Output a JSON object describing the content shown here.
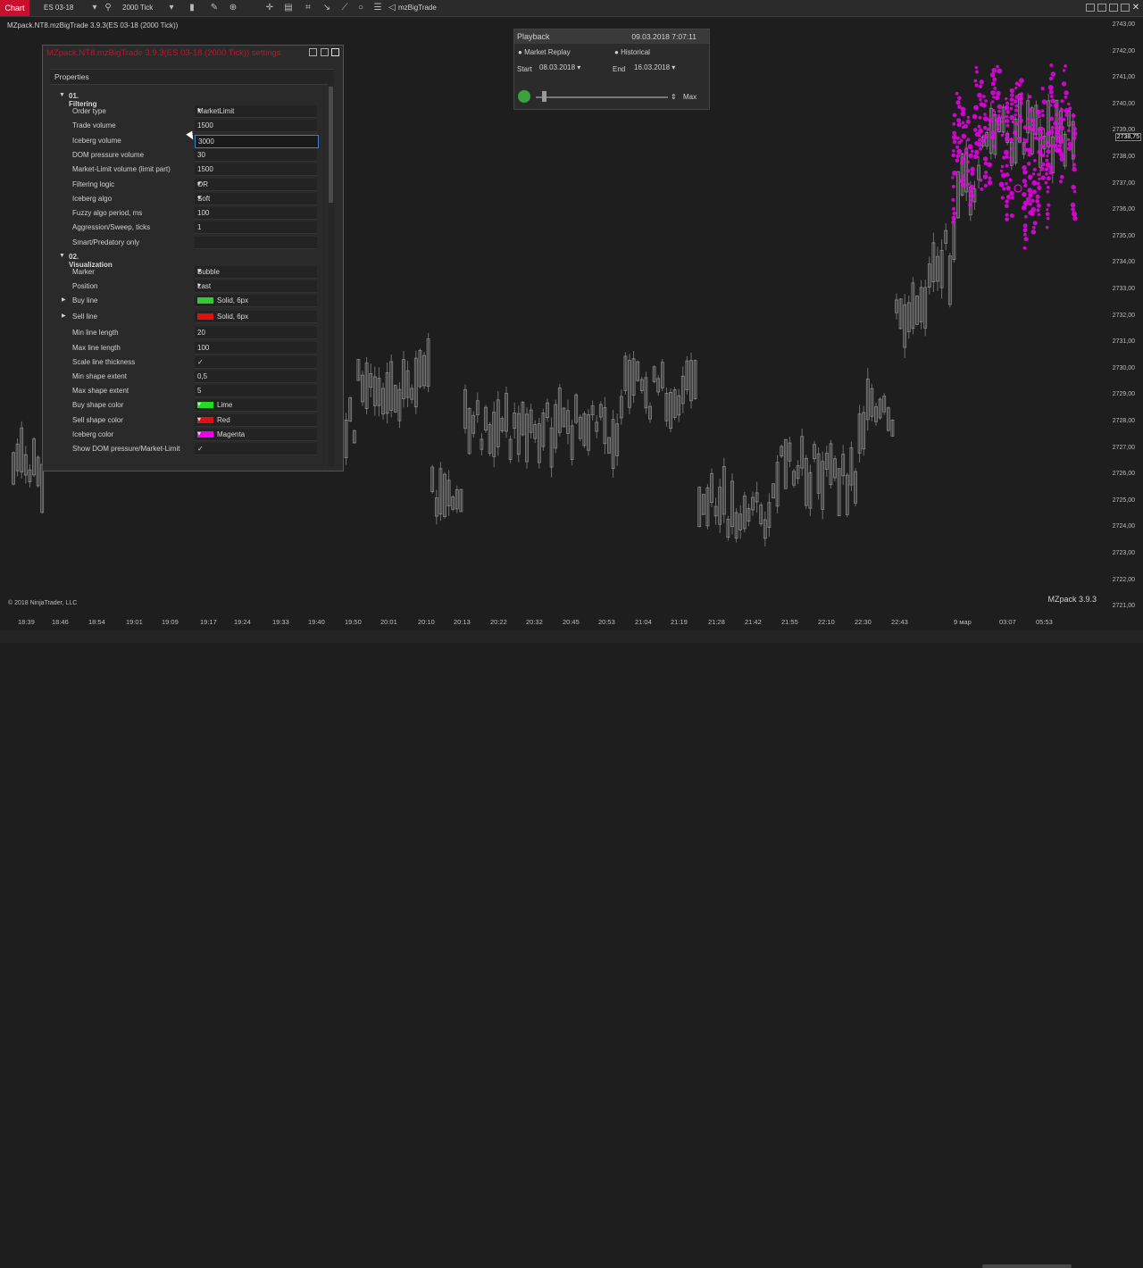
{
  "toolbar": {
    "chart_tab": "Chart",
    "instrument": "ES 03-18",
    "interval": "2000 Tick",
    "indicator": "mzBigTrade"
  },
  "chart": {
    "title": "MZpack.NT8.mzBigTrade 3.9.3(ES 03-18 (2000 Tick))",
    "copyright": "© 2018 NinjaTrader, LLC",
    "brand": "MZpack 3.9.3",
    "current_price": "2738,75",
    "price_labels": [
      "2743,00",
      "2742,00",
      "2741,00",
      "2740,00",
      "2739,00",
      "2738,00",
      "2737,00",
      "2736,00",
      "2735,00",
      "2734,00",
      "2733,00",
      "2732,00",
      "2731,00",
      "2730,00",
      "2729,00",
      "2728,00",
      "2727,00",
      "2726,00",
      "2725,00",
      "2724,00",
      "2723,00",
      "2722,00",
      "2721,00"
    ],
    "time_labels": [
      "18:39",
      "18:46",
      "18:54",
      "19:01",
      "19:09",
      "19:17",
      "19:24",
      "19:33",
      "19:40",
      "19:50",
      "20:01",
      "20:10",
      "20:13",
      "20:22",
      "20:32",
      "20:45",
      "20:53",
      "21:04",
      "21:19",
      "21:28",
      "21:42",
      "21:55",
      "22:10",
      "22:30",
      "22:43",
      "9 мар",
      "03:07",
      "05:53"
    ]
  },
  "settings": {
    "title": "MZpack.NT8.mzBigTrade 3.9.3(ES 03-18 (2000 Tick)) settings",
    "properties_label": "Properties",
    "section1": "01. Filtering",
    "section2": "02. Visualization",
    "filtering": [
      {
        "label": "Order type",
        "value": "MarketLimit",
        "dropdown": true
      },
      {
        "label": "Trade volume",
        "value": "1500"
      },
      {
        "label": "Iceberg volume",
        "value": "3000",
        "active": true
      },
      {
        "label": "DOM pressure volume",
        "value": "30"
      },
      {
        "label": "Market-Limit volume (limit part)",
        "value": "1500"
      },
      {
        "label": "Filtering logic",
        "value": "OR",
        "dropdown": true
      },
      {
        "label": "Iceberg algo",
        "value": "Soft",
        "dropdown": true
      },
      {
        "label": "Fuzzy algo period, ms",
        "value": "100"
      },
      {
        "label": "Aggression/Sweep, ticks",
        "value": "1"
      },
      {
        "label": "Smart/Predatory only",
        "value": ""
      }
    ],
    "visualization": [
      {
        "label": "Marker",
        "value": "Bubble",
        "dropdown": true
      },
      {
        "label": "Position",
        "value": "Last",
        "dropdown": true
      },
      {
        "label": "Buy line",
        "value": "Solid, 6px",
        "swatch": "#2ecc2e",
        "expandable": true
      },
      {
        "label": "Sell line",
        "value": "Solid, 6px",
        "swatch": "#e01010",
        "expandable": true
      },
      {
        "label": "Min line length",
        "value": "20"
      },
      {
        "label": "Max line length",
        "value": "100"
      },
      {
        "label": "Scale line thickness",
        "value": "✓"
      },
      {
        "label": "Min shape extent",
        "value": "0,5"
      },
      {
        "label": "Max shape extent",
        "value": "5"
      },
      {
        "label": "Buy shape color",
        "value": "Lime",
        "swatch": "#22dd22",
        "dropdown": true
      },
      {
        "label": "Sell shape color",
        "value": "Red",
        "swatch": "#e01010",
        "dropdown": true
      },
      {
        "label": "Iceberg color",
        "value": "Magenta",
        "swatch": "#ee00ee",
        "dropdown": true
      },
      {
        "label": "Show DOM pressure/Market-Limit",
        "value": "✓"
      }
    ]
  },
  "playback": {
    "title": "Playback",
    "datetime": "09.03.2018 7:07:11",
    "market_replay": "Market Replay",
    "historical": "Historical",
    "start_label": "Start",
    "start_date": "08.03.2018",
    "end_label": "End",
    "end_date": "16.03.2018",
    "max_label": "Max"
  },
  "colors": {
    "accent_red": "#c8102e",
    "iceberg": "#ee00ee",
    "candle": "#8a8a8a"
  }
}
